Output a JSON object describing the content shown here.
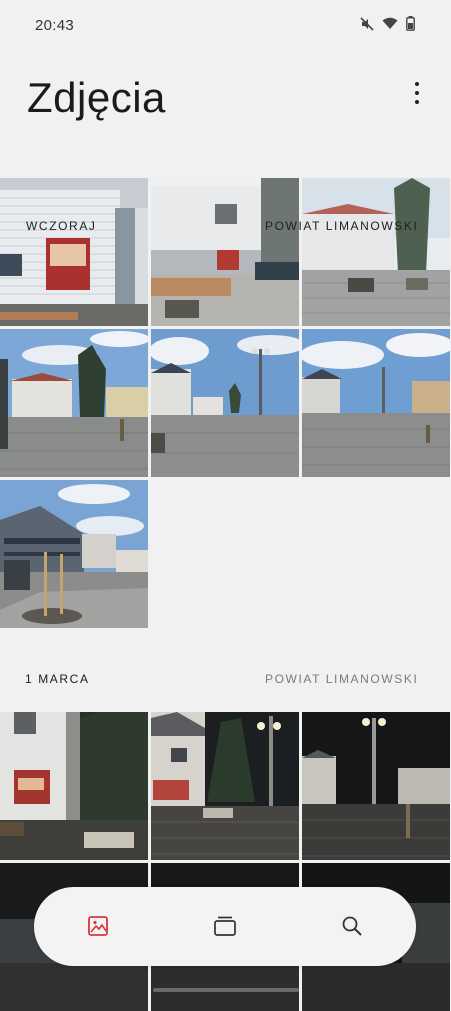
{
  "status": {
    "time": "20:43"
  },
  "header": {
    "title": "Zdjęcia"
  },
  "sections": [
    {
      "label": "WCZORAJ",
      "location": "POWIAT LIMANOWSKI"
    },
    {
      "label": "1 MARCA",
      "location": "POWIAT LIMANOWSKI"
    }
  ],
  "colors": {
    "accent": "#d0393f",
    "background": "#f2f1f1"
  },
  "nav": [
    {
      "name": "photos-icon",
      "active": true
    },
    {
      "name": "albums-icon",
      "active": false
    },
    {
      "name": "search-icon",
      "active": false
    }
  ]
}
